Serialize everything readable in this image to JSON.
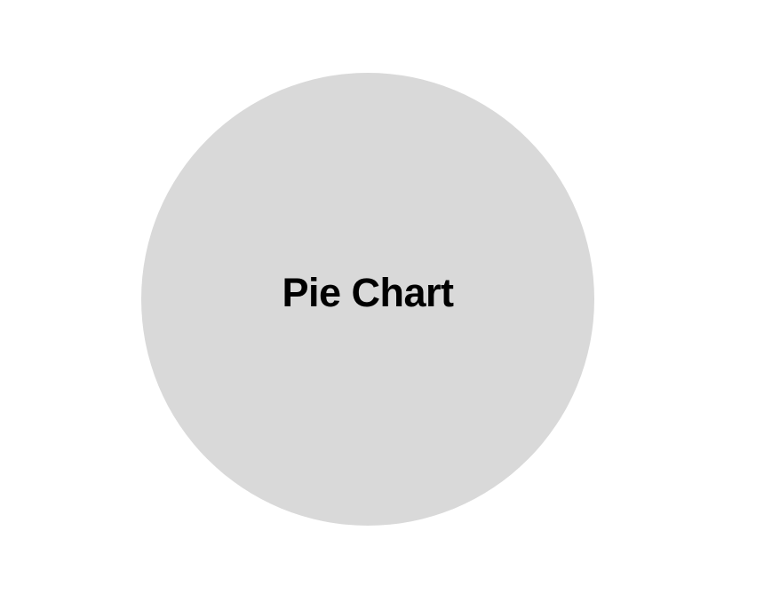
{
  "placeholder": {
    "label": "Pie Chart",
    "fill_color": "#d9d9d9",
    "text_color": "#000000",
    "background_color": "#ffffff"
  }
}
